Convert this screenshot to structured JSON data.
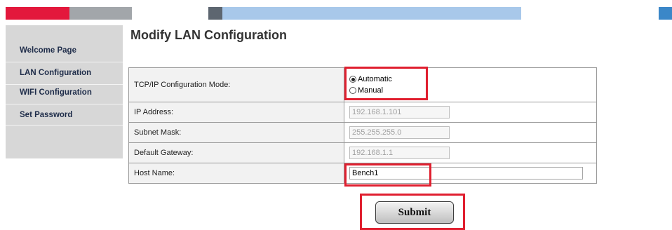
{
  "colors": {
    "banner_red": "#e3183c",
    "banner_gray": "#a2a6aa",
    "banner_dark": "#5d6670",
    "banner_lightblue": "#a8c8ea",
    "banner_blue": "#3b87c8",
    "sidebar_bg": "#d7d7d7",
    "highlight": "#e01f2f"
  },
  "sidebar": {
    "items": [
      {
        "label": "Welcome Page"
      },
      {
        "label": "LAN Configuration"
      },
      {
        "label": "WIFI Configuration"
      },
      {
        "label": "Set Password"
      }
    ]
  },
  "main": {
    "title": "Modify LAN Configuration",
    "mode": {
      "label": "TCP/IP Configuration Mode:",
      "options": [
        "Automatic",
        "Manual"
      ],
      "selected": "Automatic"
    },
    "ip": {
      "label": "IP Address:",
      "value": "192.168.1.101"
    },
    "subnet": {
      "label": "Subnet Mask:",
      "value": "255.255.255.0"
    },
    "gateway": {
      "label": "Default Gateway:",
      "value": "192.168.1.1"
    },
    "host": {
      "label": "Host Name:",
      "value": "Bench1"
    },
    "submit_label": "Submit"
  }
}
